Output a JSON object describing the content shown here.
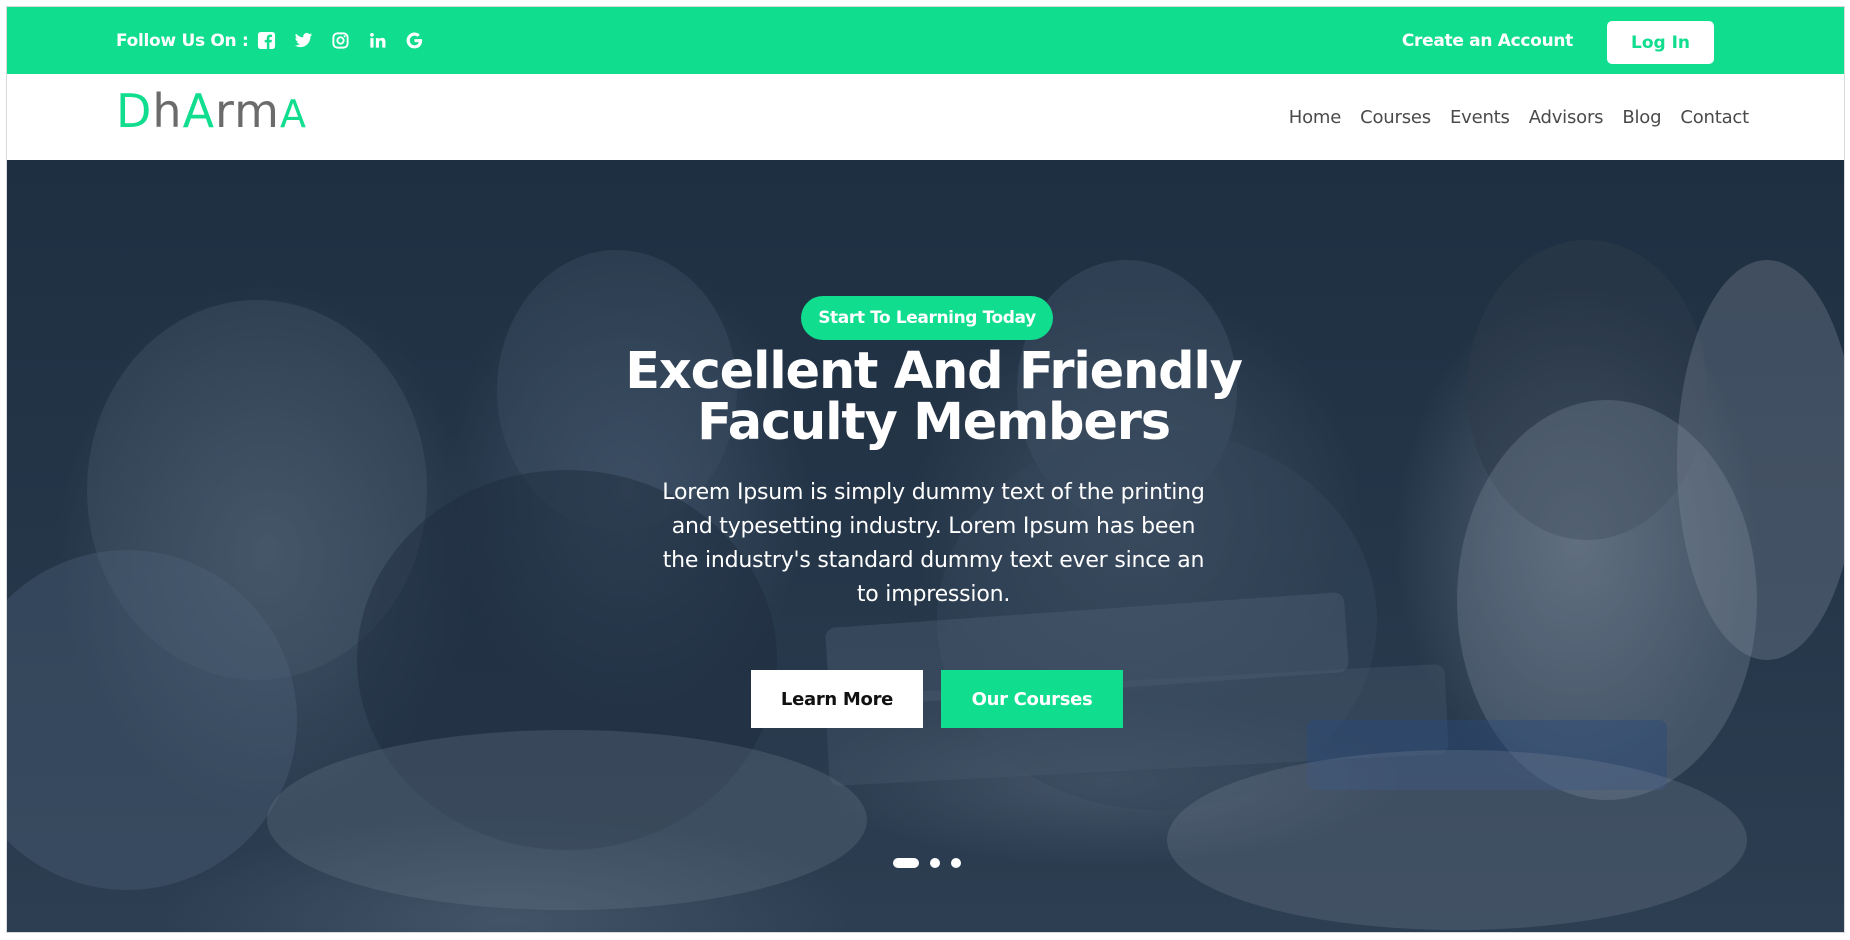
{
  "topbar": {
    "follow_label": "Follow Us On :",
    "social_icons": [
      "facebook-icon",
      "twitter-icon",
      "instagram-icon",
      "linkedin-icon",
      "google-icon"
    ],
    "create_account": "Create an Account",
    "login": "Log In"
  },
  "logo": {
    "parts": [
      "D",
      "h",
      "A",
      "r",
      "m",
      "A"
    ]
  },
  "nav": {
    "items": [
      "Home",
      "Courses",
      "Events",
      "Advisors",
      "Blog",
      "Contact"
    ]
  },
  "hero": {
    "badge": "Start To Learning Today",
    "title": "Excellent And Friendly Faculty Members",
    "description": "Lorem Ipsum is simply dummy text of the printing and typesetting industry. Lorem Ipsum has been the industry's standard dummy text ever since an to impression.",
    "learn_more": "Learn More",
    "our_courses": "Our Courses",
    "slides_total": 3,
    "active_slide": 1
  },
  "colors": {
    "accent": "#10dd8e",
    "hero_overlay": "#1f2f42",
    "text_dark": "#4a4a4a"
  }
}
